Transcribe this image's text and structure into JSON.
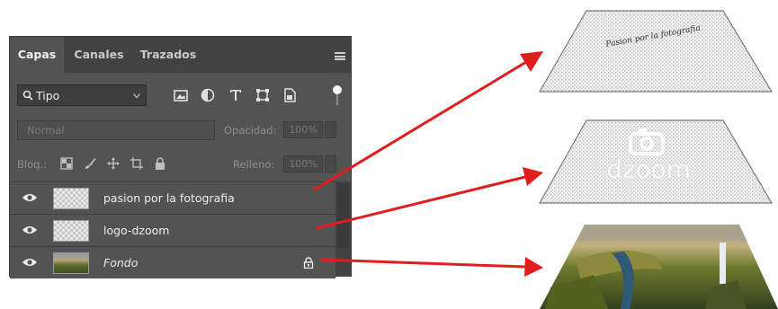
{
  "panel": {
    "tabs": [
      {
        "label": "Capas",
        "active": true
      },
      {
        "label": "Canales",
        "active": false
      },
      {
        "label": "Trazados",
        "active": false
      }
    ],
    "filter": {
      "label": "Tipo"
    },
    "blend_mode": "Normal",
    "opacity": {
      "label": "Opacidad:",
      "value": "100%"
    },
    "lock": {
      "label": "Bloq.:"
    },
    "fill": {
      "label": "Relleno:",
      "value": "100%"
    },
    "layers": [
      {
        "name": "pasion por la fotografia",
        "visible": true,
        "thumbnail": "transparent",
        "locked": false
      },
      {
        "name": "logo-dzoom",
        "visible": true,
        "thumbnail": "transparent",
        "locked": false
      },
      {
        "name": "Fondo",
        "visible": true,
        "thumbnail": "photo",
        "locked": true
      }
    ]
  },
  "illustration": {
    "top_layer_text": "Pasion por la fotografia",
    "middle_layer_text": "dzoom"
  },
  "colors": {
    "arrow": "#e21d1d",
    "panel_bg": "#535353",
    "tab_bar": "#424242"
  }
}
